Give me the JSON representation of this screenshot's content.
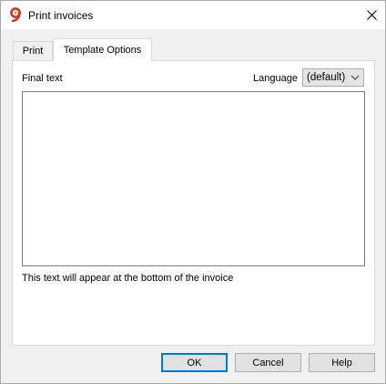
{
  "window": {
    "title": "Print invoices",
    "app_icon": "banana-9-icon",
    "close_icon": "close-icon"
  },
  "tabs": [
    {
      "label": "Print",
      "active": false
    },
    {
      "label": "Template Options",
      "active": true
    }
  ],
  "template_options": {
    "final_text_label": "Final text",
    "language_label": "Language",
    "language_value": "(default)",
    "final_text_value": "",
    "hint": "This text will appear at the bottom of the invoice"
  },
  "buttons": {
    "ok": "OK",
    "cancel": "Cancel",
    "help": "Help"
  },
  "colors": {
    "accent": "#0078d7",
    "icon_red": "#d9302c",
    "icon_orange": "#f4a321"
  }
}
